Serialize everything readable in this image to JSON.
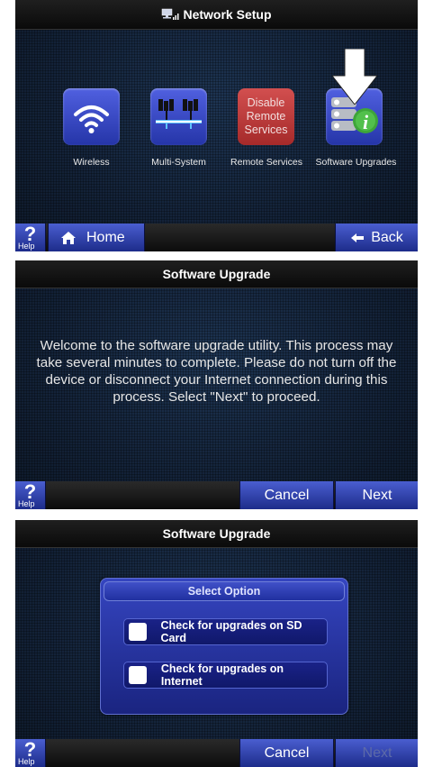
{
  "screen1": {
    "title": "Network Setup",
    "icons": [
      {
        "label": "Wireless",
        "icon": "wifi-icon"
      },
      {
        "label": "Multi-System",
        "icon": "multi-system-icon"
      },
      {
        "label": "Remote Services",
        "icon_text": "Disable\nRemote\nServices"
      },
      {
        "label": "Software Upgrades",
        "icon": "software-upgrades-icon"
      }
    ],
    "home_label": "Home",
    "back_label": "Back",
    "help_label": "Help"
  },
  "screen2": {
    "title": "Software Upgrade",
    "message": "Welcome to the software upgrade utility. This process may take several minutes to complete. Please do not turn off the device or disconnect your Internet connection during this process. Select \"Next\" to proceed.",
    "cancel_label": "Cancel",
    "next_label": "Next",
    "help_label": "Help"
  },
  "screen3": {
    "title": "Software Upgrade",
    "dialog_title": "Select Option",
    "options": [
      "Check for upgrades on SD Card",
      "Check for upgrades on Internet"
    ],
    "cancel_label": "Cancel",
    "next_label": "Next",
    "next_enabled": false,
    "help_label": "Help"
  },
  "colors": {
    "button_blue": "#2f42c0",
    "remote_red": "#c43c3c",
    "background": "#14243a"
  }
}
